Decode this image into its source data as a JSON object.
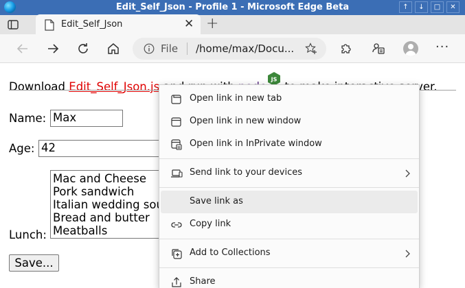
{
  "window": {
    "title": "Edit_Self_Json - Profile 1 - Microsoft Edge Beta",
    "controls": [
      "↑",
      "↓",
      "□",
      "✕"
    ]
  },
  "tab": {
    "title": "Edit_Self_Json",
    "close": "✕",
    "new": "+"
  },
  "address": {
    "label": "File",
    "url": "/home/max/Docu..."
  },
  "toolbar": {
    "more": "···"
  },
  "page": {
    "intro_prefix": "Download ",
    "download_link": "Edit_Self_Json.js",
    "intro_middle": " and run with ",
    "node_link": "node",
    "node_badge": "JS",
    "intro_suffix": " to make interactive server.",
    "name_label": "Name:",
    "name_value": "Max",
    "age_label": "Age:",
    "age_value": "42",
    "lunch_label": "Lunch:",
    "lunch_options": [
      "Mac and Cheese",
      "Pork sandwich",
      "Italian wedding soup",
      "Bread and butter",
      "Meatballs"
    ],
    "save_button": "Save..."
  },
  "context_menu": {
    "items": [
      {
        "label": "Open link in new tab",
        "icon": "new-tab-icon"
      },
      {
        "label": "Open link in new window",
        "icon": "new-window-icon"
      },
      {
        "label": "Open link in InPrivate window",
        "icon": "inprivate-icon"
      },
      {
        "label": "Send link to your devices",
        "icon": "send-devices-icon"
      },
      {
        "label": "Save link as",
        "icon": ""
      },
      {
        "label": "Copy link",
        "icon": "link-icon"
      },
      {
        "label": "Add to Collections",
        "icon": "collections-icon"
      },
      {
        "label": "Share",
        "icon": "share-icon"
      }
    ],
    "highlighted_item": "Save link as"
  },
  "colors": {
    "titlebar": "#3b6eb5",
    "link_red": "#e00000",
    "link_visited": "#5a2d82",
    "node_green": "#3c873a",
    "menu_highlight": "#ebebeb"
  }
}
